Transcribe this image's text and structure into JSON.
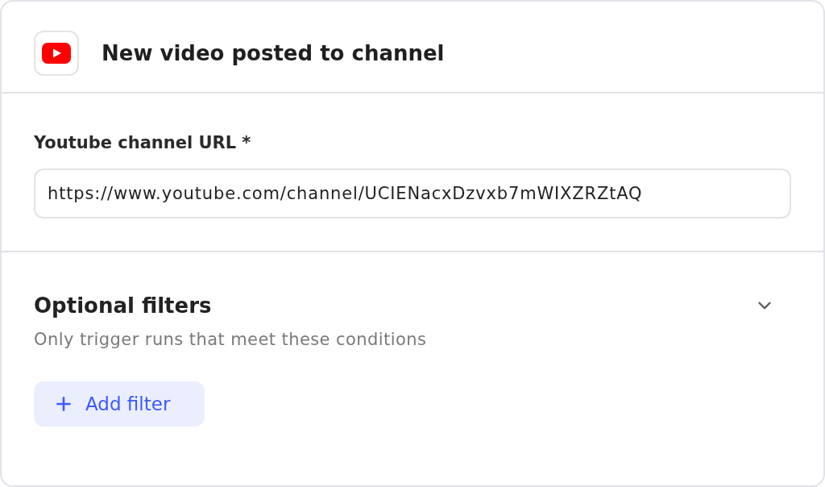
{
  "header": {
    "title": "New video posted to channel"
  },
  "url_field": {
    "label": "Youtube channel URL *",
    "value": "https://www.youtube.com/channel/UCIENacxDzvxb7mWIXZRZtAQ"
  },
  "filters": {
    "title": "Optional filters",
    "description": "Only trigger runs that meet these conditions",
    "add_button": "Add filter"
  }
}
